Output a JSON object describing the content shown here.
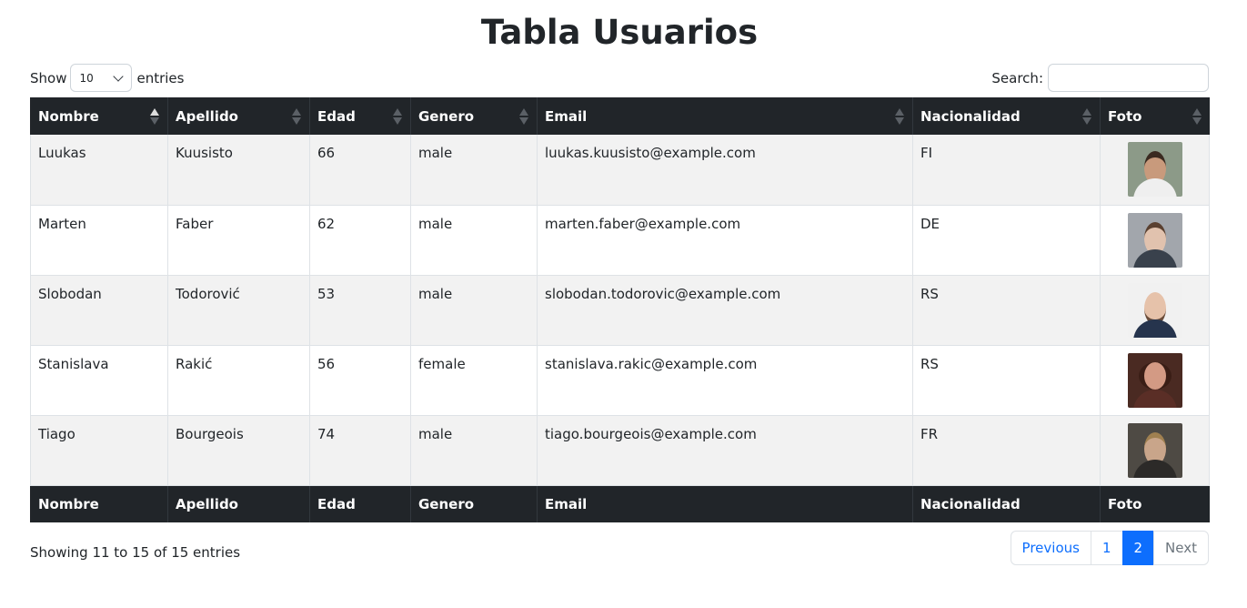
{
  "title": "Tabla Usuarios",
  "length": {
    "show_label": "Show",
    "selected": "10",
    "entries_label": "entries"
  },
  "search": {
    "label": "Search:",
    "value": ""
  },
  "table": {
    "columns": [
      "Nombre",
      "Apellido",
      "Edad",
      "Genero",
      "Email",
      "Nacionalidad",
      "Foto"
    ],
    "sorted_column": "Nombre",
    "sort_direction": "ascending",
    "rows": [
      {
        "nombre": "Luukas",
        "apellido": "Kuusisto",
        "edad": "66",
        "genero": "male",
        "email": "luukas.kuusisto@example.com",
        "nacionalidad": "FI"
      },
      {
        "nombre": "Marten",
        "apellido": "Faber",
        "edad": "62",
        "genero": "male",
        "email": "marten.faber@example.com",
        "nacionalidad": "DE"
      },
      {
        "nombre": "Slobodan",
        "apellido": "Todorović",
        "edad": "53",
        "genero": "male",
        "email": "slobodan.todorovic@example.com",
        "nacionalidad": "RS"
      },
      {
        "nombre": "Stanislava",
        "apellido": "Rakić",
        "edad": "56",
        "genero": "female",
        "email": "stanislava.rakic@example.com",
        "nacionalidad": "RS"
      },
      {
        "nombre": "Tiago",
        "apellido": "Bourgeois",
        "edad": "74",
        "genero": "male",
        "email": "tiago.bourgeois@example.com",
        "nacionalidad": "FR"
      }
    ]
  },
  "info": "Showing 11 to 15 of 15 entries",
  "pagination": {
    "previous": "Previous",
    "pages": [
      "1",
      "2"
    ],
    "current": "2",
    "next": "Next"
  },
  "colors": {
    "header_bg": "#212529",
    "stripe_bg": "#f2f2f2",
    "accent": "#0d6efd"
  }
}
